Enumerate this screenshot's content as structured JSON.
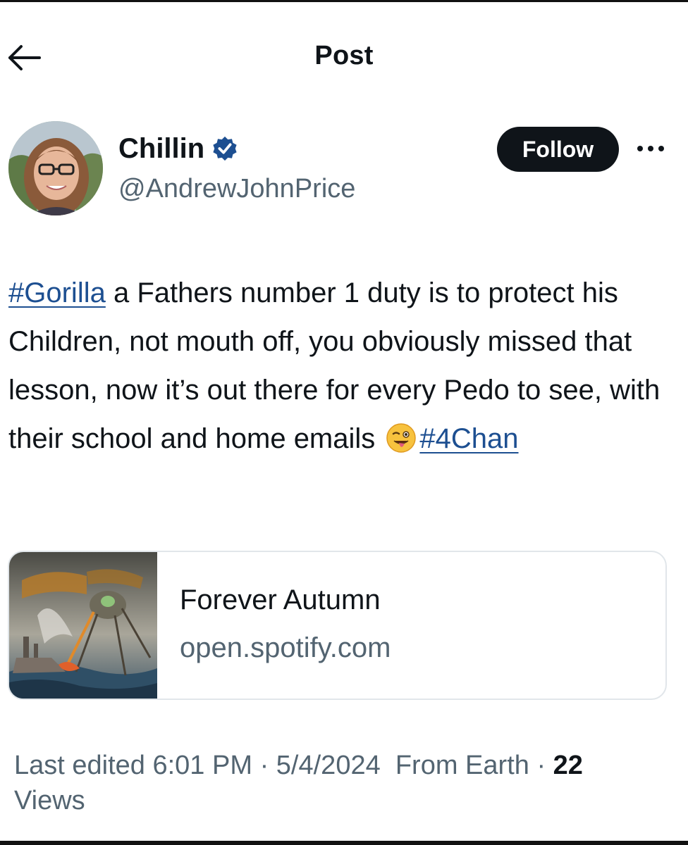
{
  "header": {
    "title": "Post"
  },
  "author": {
    "display_name": "Chillin",
    "handle": "@AndrewJohnPrice",
    "verified": true,
    "avatar_icon": "profile-photo"
  },
  "actions": {
    "follow_label": "Follow",
    "more_icon": "more-horizontal-icon"
  },
  "post": {
    "hashtag_1": "#Gorilla",
    "text": " a Fathers number 1 duty is to protect his Children, not mouth off, you obviously missed that lesson, now it’s out there for every Pedo to see, with their school and home emails ",
    "emoji": "winking-face-with-tongue",
    "hashtag_2": "#4Chan"
  },
  "link_card": {
    "title": "Forever Autumn",
    "domain": "open.spotify.com",
    "thumbnail": "album-art-war-of-the-worlds"
  },
  "meta": {
    "edited_label": "Last edited",
    "time": "6:01 PM",
    "separator": "·",
    "date": "5/4/2024",
    "source": "From Earth",
    "views_count": "22",
    "views_label": "Views"
  },
  "colors": {
    "link": "#1d4f91",
    "verified": "#1d4f91",
    "text": "#0f1419",
    "secondary": "#536471"
  }
}
